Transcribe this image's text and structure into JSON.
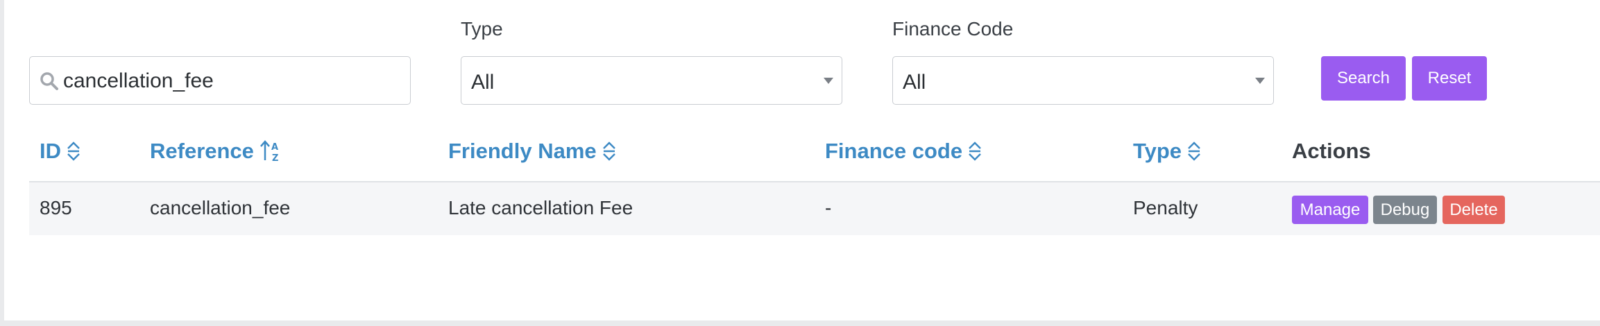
{
  "filters": {
    "search": {
      "value": "cancellation_fee",
      "icon": "search-icon"
    },
    "type": {
      "label": "Type",
      "selected": "All"
    },
    "finance_code": {
      "label": "Finance Code",
      "selected": "All"
    },
    "search_button": "Search",
    "reset_button": "Reset"
  },
  "table": {
    "columns": {
      "id": "ID",
      "reference": "Reference",
      "friendly_name": "Friendly Name",
      "finance_code": "Finance code",
      "type": "Type",
      "actions": "Actions"
    },
    "rows": [
      {
        "id": "895",
        "reference": "cancellation_fee",
        "friendly_name": "Late cancellation Fee",
        "finance_code": "-",
        "type": "Penalty",
        "actions": {
          "manage": "Manage",
          "debug": "Debug",
          "delete": "Delete"
        }
      }
    ]
  },
  "colors": {
    "accent": "#9a5cf0",
    "link": "#3d8ac4",
    "debug": "#7c858d",
    "delete": "#e5665e"
  }
}
